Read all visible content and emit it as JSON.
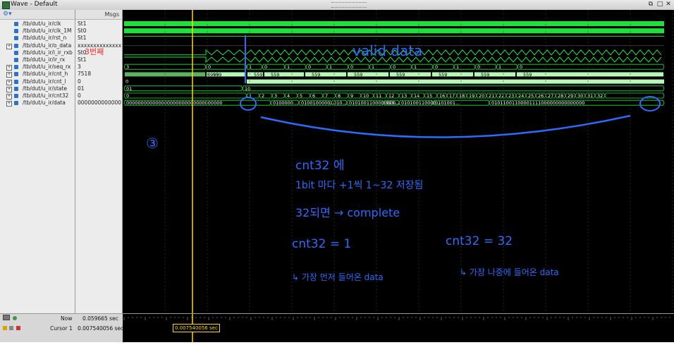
{
  "window": {
    "title": "Wave - Default"
  },
  "columns": {
    "msgs": "Msgs"
  },
  "signals": [
    {
      "name": "/tb/dut/u_ir/clk",
      "value": "St1",
      "expand": false
    },
    {
      "name": "/tb/dut/u_ir/clk_1M",
      "value": "St0",
      "expand": false
    },
    {
      "name": "/tb/dut/u_ir/rst_n",
      "value": "St1",
      "expand": false
    },
    {
      "name": "/tb/dut/u_ir/o_data",
      "value": "xxxxxxxxxxxxxxxx...",
      "expand": true
    },
    {
      "name": "/tb/dut/u_ir/i_ir_rxb",
      "value": "St0",
      "expand": false
    },
    {
      "name": "/tb/dut/u_ir/ir_rx",
      "value": "St1",
      "expand": false
    },
    {
      "name": "/tb/dut/u_ir/seq_rx",
      "value": "3",
      "expand": true
    },
    {
      "name": "/tb/dut/u_ir/cnt_h",
      "value": "7518",
      "expand": true
    },
    {
      "name": "/tb/dut/u_ir/cnt_l",
      "value": "0",
      "expand": true
    },
    {
      "name": "/tb/dut/u_ir/state",
      "value": "01",
      "expand": true
    },
    {
      "name": "/tb/dut/u_ir/cnt32",
      "value": "0",
      "expand": true
    },
    {
      "name": "/tb/dut/u_ir/data",
      "value": "0000000000000000...",
      "expand": true
    }
  ],
  "wave_labels": {
    "seq_rx": [
      "3",
      "0",
      "1",
      "0",
      "1",
      "0",
      "1",
      "0",
      "1",
      "0",
      "1",
      "0",
      "1",
      "0",
      "1",
      "0"
    ],
    "cnt_h": [
      "8999",
      "559",
      "559",
      "559",
      "559",
      "559",
      "559",
      "559",
      "559",
      "559"
    ],
    "state": [
      "01",
      "10"
    ],
    "cnt32": [
      "0",
      "1",
      "2",
      "3",
      "4",
      "5",
      "6",
      "7",
      "8",
      "9",
      "10",
      "11",
      "12",
      "13",
      "14",
      "15",
      "16",
      "17",
      "18",
      "19",
      "20",
      "21",
      "22",
      "23",
      "24",
      "25",
      "26",
      "27",
      "28",
      "29",
      "30",
      "31",
      "32"
    ],
    "data": [
      "000000000000000000000000000000000",
      "0100000...",
      "0100100000...",
      "010...",
      "0101001100000000...",
      "010...",
      "010100110000...",
      "0101001...",
      "01011001100001111000000000000000"
    ]
  },
  "status": {
    "now_label": "Now",
    "now_value": "0.059665 sec",
    "cursor_label": "Cursor 1",
    "cursor_value": "0.007540056 sec",
    "cursor_marker": "0.007540056 sec"
  },
  "annotations": {
    "marker_1": "3번째",
    "valid_data": "valid data",
    "step_number": "③",
    "note_1": "cnt32 에",
    "note_2": "1bit 마다 +1씩 1~32 저장됨",
    "note_3": "32되면 → complete",
    "note_4": "cnt32 = 1",
    "note_5": "↳ 가장 먼저 들어온 data",
    "note_6": "cnt32 = 32",
    "note_7": "↳ 가장 나중에 들어온 data"
  },
  "colors": {
    "wave_green": "#22e03a",
    "bus_green": "#b7f7b7",
    "cursor": "#ffd800",
    "ink_blue": "#2b6cff",
    "ink_red": "#ff2a2a"
  }
}
